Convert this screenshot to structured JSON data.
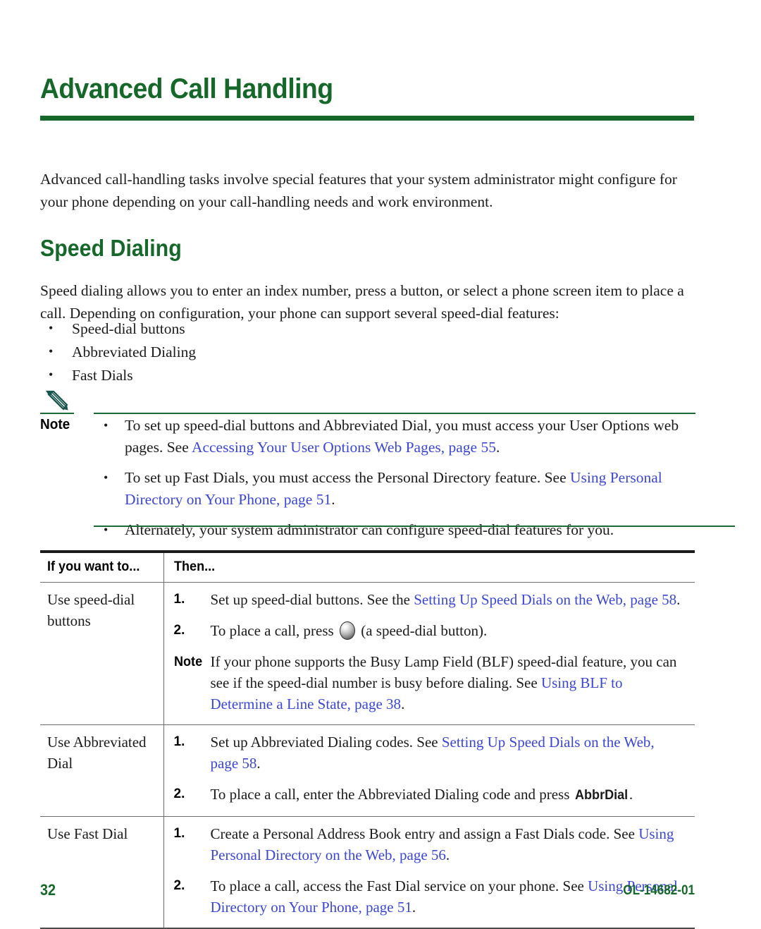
{
  "page": {
    "chapter_title": "Advanced Call Handling",
    "intro_paragraph": "Advanced call-handling tasks involve special features that your system administrator might configure for your phone depending on your call-handling needs and work environment.",
    "section_title": "Speed Dialing",
    "section_paragraph": "Speed dialing allows you to enter an index number, press a button, or select a phone screen item to place a call. Depending on configuration, your phone can support several speed-dial features:",
    "features": [
      "Speed-dial buttons",
      "Abbreviated Dialing",
      "Fast Dials"
    ]
  },
  "note": {
    "label": "Note",
    "icon": "pencil-icon",
    "bullets": [
      {
        "text_before": "To set up speed-dial buttons and Abbreviated Dial, you must access your User Options web pages. See ",
        "link": "Accessing Your User Options Web Pages, page 55",
        "text_after": "."
      },
      {
        "text_before": "To set up Fast Dials, you must access the Personal Directory feature. See ",
        "link": "Using Personal Directory on Your Phone, page 51",
        "text_after": "."
      },
      {
        "text_before": "Alternately, your system administrator can configure speed-dial features for you.",
        "link": "",
        "text_after": ""
      }
    ]
  },
  "table": {
    "headers": {
      "col1": "If you want to...",
      "col2": "Then..."
    },
    "rows": [
      {
        "task": "Use speed-dial buttons",
        "steps": [
          {
            "num": "1.",
            "text_before": "Set up speed-dial buttons. See the ",
            "link": "Setting Up Speed Dials on the Web, page 58",
            "text_after": "."
          },
          {
            "num": "2.",
            "text_before": "To place a call, press ",
            "icon": "speed-dial-button-icon",
            "text_mid": " (a speed-dial button).",
            "link": "",
            "text_after": ""
          }
        ],
        "note": {
          "label": "Note",
          "text_before": "If your phone supports the Busy Lamp Field (BLF) speed-dial feature, you can see if the speed-dial number is busy before dialing. See ",
          "link": "Using BLF to Determine a Line State, page 38",
          "text_after": "."
        }
      },
      {
        "task": "Use Abbreviated Dial",
        "steps": [
          {
            "num": "1.",
            "text_before": "Set up Abbreviated Dialing codes. See ",
            "link": "Setting Up Speed Dials on the Web, page 58",
            "text_after": "."
          },
          {
            "num": "2.",
            "text_before": "To place a call, enter the Abbreviated Dialing code and press ",
            "bold": "AbbrDial",
            "text_after": "."
          }
        ]
      },
      {
        "task": "Use Fast Dial",
        "steps": [
          {
            "num": "1.",
            "text_before": "Create a Personal Address Book entry and assign a Fast Dials code. See ",
            "link": "Using Personal Directory on the Web, page 56",
            "text_after": "."
          },
          {
            "num": "2.",
            "text_before": "To place a call, access the Fast Dial service on your phone. See ",
            "link": "Using Personal Directory on Your Phone, page 51",
            "text_after": "."
          }
        ]
      }
    ]
  },
  "footer": {
    "page_number": "32",
    "document_id": "OL-14682-01"
  },
  "colors": {
    "brand_green": "#16672a",
    "link_blue": "#3b47d4",
    "note_rule_green": "#1d6b34",
    "body_text": "#1b1b1b"
  }
}
